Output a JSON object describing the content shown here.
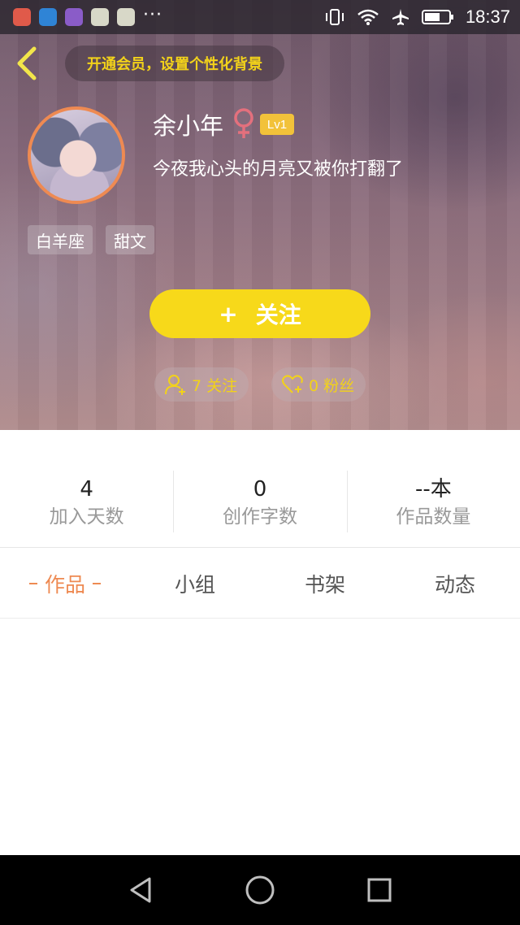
{
  "status_bar": {
    "time": "18:37",
    "more": "···",
    "app_icons": [
      "mail-app-icon",
      "map-app-icon",
      "gallery-app-icon",
      "chat-app-icon",
      "chat-app-icon-2"
    ],
    "right_icons": [
      "vibrate-icon",
      "wifi-icon",
      "airplane-icon",
      "battery-icon"
    ]
  },
  "header": {
    "vip_prompt": "开通会员，设置个性化背景",
    "back_icon": "chevron-left-icon"
  },
  "profile": {
    "username": "余小年",
    "gender_icon": "female-icon",
    "level": "Lv1",
    "signature": "今夜我心头的月亮又被你打翻了",
    "tags": [
      "白羊座",
      "甜文"
    ],
    "follow_button": {
      "plus": "+",
      "label": "关注"
    },
    "following": "7 关注",
    "fans": "0 粉丝"
  },
  "stats": [
    {
      "value": "4",
      "label": "加入天数"
    },
    {
      "value": "0",
      "label": "创作字数"
    },
    {
      "value": "--本",
      "label": "作品数量"
    }
  ],
  "tabs": [
    {
      "label": "作品",
      "active": true
    },
    {
      "label": "小组",
      "active": false
    },
    {
      "label": "书架",
      "active": false
    },
    {
      "label": "动态",
      "active": false
    }
  ],
  "nav_bar": [
    "back-triangle-icon",
    "home-circle-icon",
    "recents-square-icon"
  ],
  "colors": {
    "accent_yellow": "#f7d91a",
    "accent_orange": "#ee8a52",
    "level_badge": "#f2c23a",
    "gender_pink": "#e4707d"
  }
}
